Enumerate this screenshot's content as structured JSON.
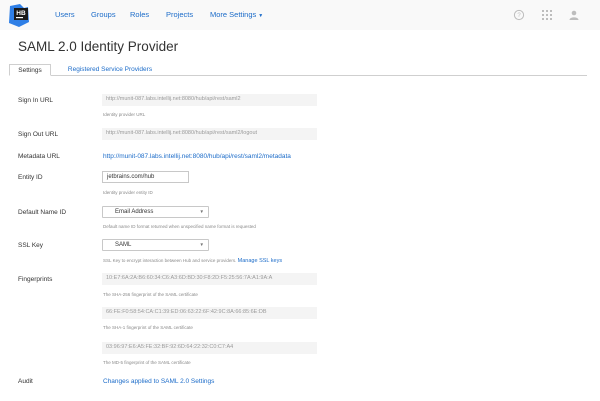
{
  "header": {
    "logo_text": "HB",
    "nav": [
      {
        "label": "Users"
      },
      {
        "label": "Groups"
      },
      {
        "label": "Roles"
      },
      {
        "label": "Projects"
      },
      {
        "label": "More Settings"
      }
    ],
    "icons": [
      "help-icon",
      "apps-grid-icon",
      "user-avatar-icon"
    ]
  },
  "page": {
    "title": "SAML 2.0 Identity Provider"
  },
  "tabs": [
    {
      "label": "Settings",
      "active": true
    },
    {
      "label": "Registered Service Providers",
      "active": false
    }
  ],
  "form": {
    "sign_in_url": {
      "label": "Sign In URL",
      "value": "http://munit-087.labs.intellij.net:8080/hub/api/rest/saml2",
      "hint": "Identity provider URL"
    },
    "sign_out_url": {
      "label": "Sign Out URL",
      "value": "http://munit-087.labs.intellij.net:8080/hub/api/rest/saml2/logout"
    },
    "metadata_url": {
      "label": "Metadata URL",
      "value": "http://munit-087.labs.intellij.net:8080/hub/api/rest/saml2/metadata"
    },
    "entity_id": {
      "label": "Entity ID",
      "value": "jetbrains.com/hub",
      "hint": "Identity provider entity ID"
    },
    "default_name_id": {
      "label": "Default Name ID",
      "value": "Email Address",
      "hint": "Default name ID format returned when unspecified name format is requested"
    },
    "ssl_key": {
      "label": "SSL Key",
      "value": "SAML",
      "hint": "SSL Key to encrypt interaction between Hub and service providers.",
      "link": "Manage SSL keys"
    },
    "fingerprints": {
      "label": "Fingerprints",
      "items": [
        {
          "value": "10:E7:6A:2A:B6:60:34:C6:A3:6D:BD:30:F8:2D:F5:25:56:7A:A1:9A:A",
          "hint": "The SHA-256 fingerprint of the SAML certificate"
        },
        {
          "value": "66:FE:F0:58:54:CA:C1:39:ED:06:63:22:6F:42:9C:8A:66:85:6E:DB",
          "hint": "The SHA-1 fingerprint of the SAML certificate"
        },
        {
          "value": "03:96:97:E6:A5:FE:32:BF:92:6D:64:22:32:C0:C7:A4",
          "hint": "The MD-5 fingerprint of the SAML certificate"
        }
      ]
    },
    "audit": {
      "label": "Audit",
      "link": "Changes applied to SAML 2.0 Settings"
    }
  },
  "colors": {
    "link": "#1c6cc9",
    "topbar_bg": "#f9f9f9",
    "readonly_bg": "#f4f4f4",
    "logo_bg": "#1a1a1a",
    "logo_accent": "#3d8ef0"
  }
}
